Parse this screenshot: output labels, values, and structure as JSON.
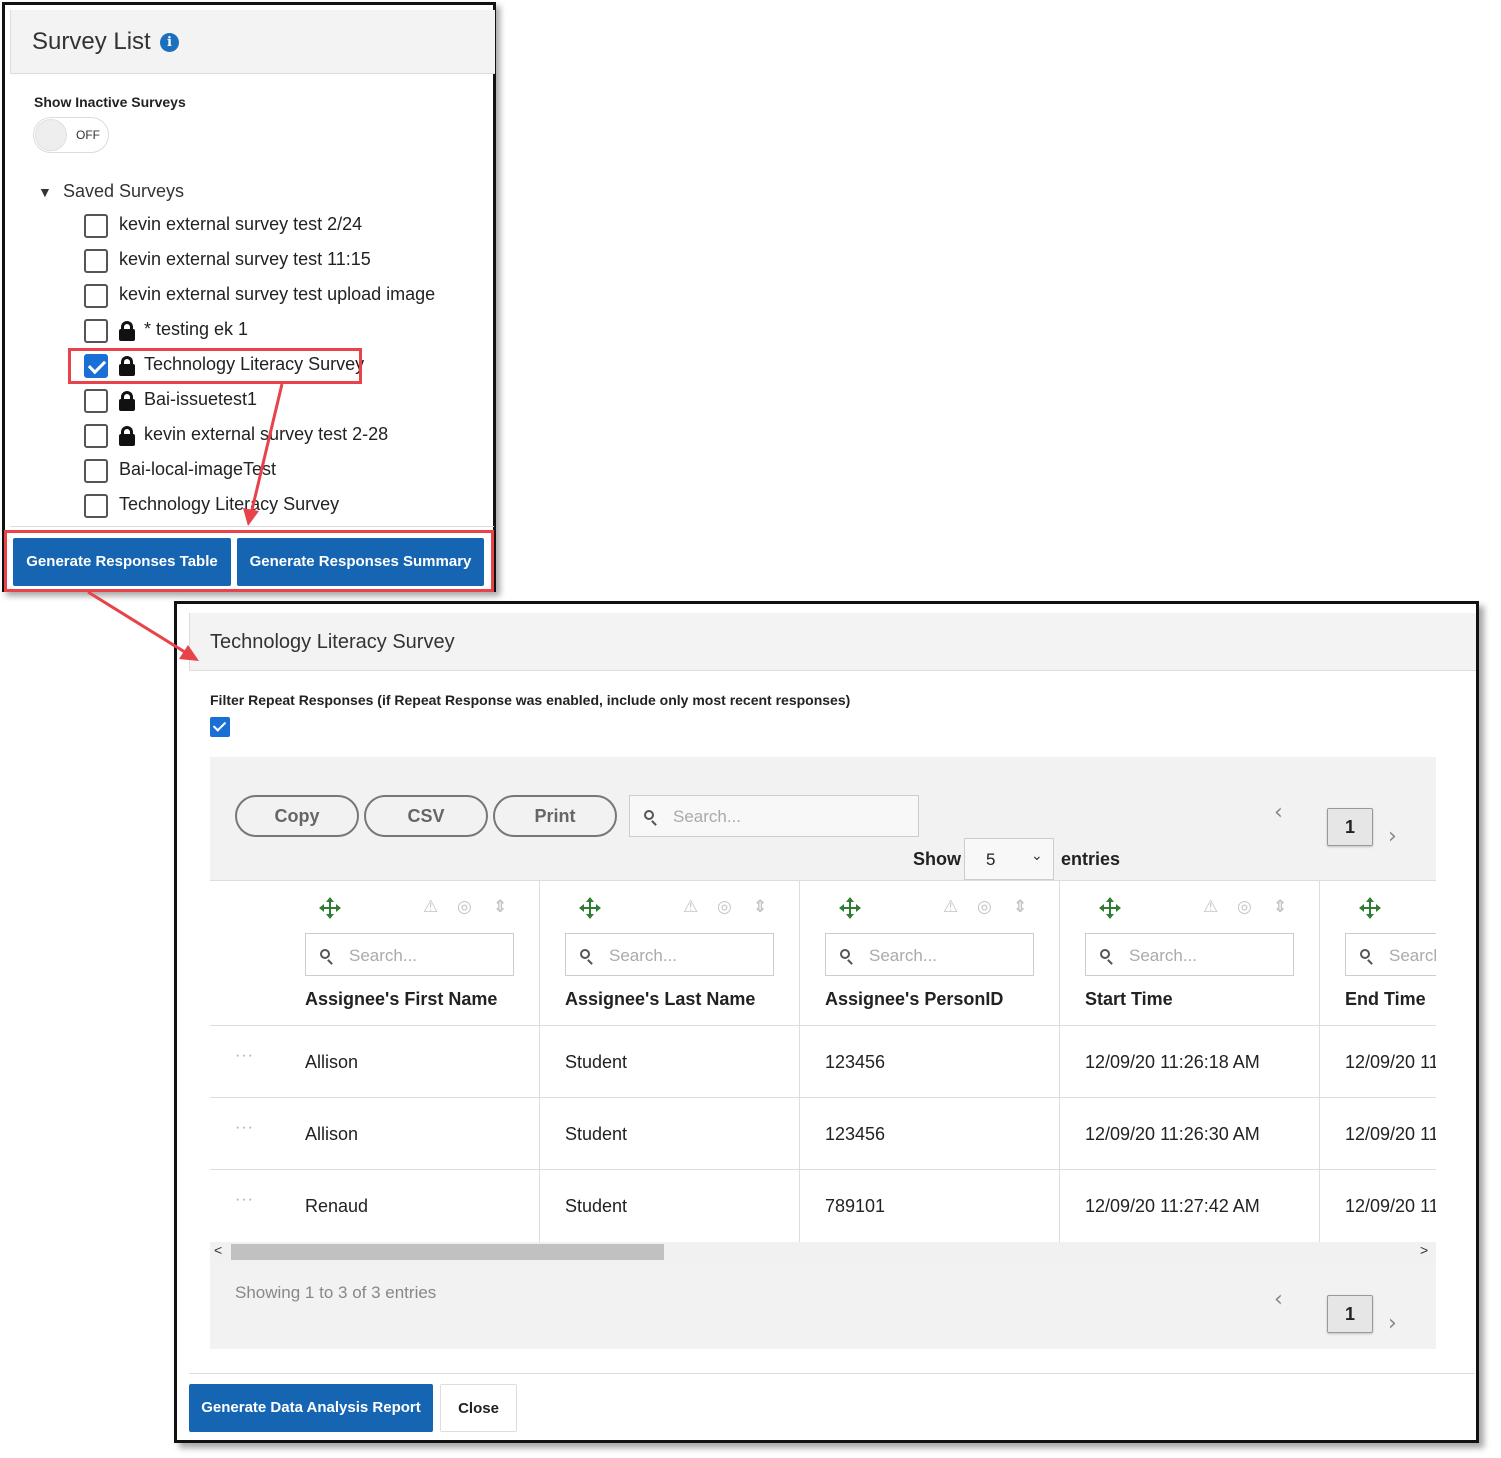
{
  "survey_list": {
    "title": "Survey List",
    "info_icon": "info-icon",
    "show_inactive_label": "Show Inactive Surveys",
    "toggle_state": "OFF",
    "saved_surveys_label": "Saved Surveys",
    "items": [
      {
        "label": "kevin external survey test 2/24",
        "checked": false,
        "locked": false
      },
      {
        "label": "kevin external survey test 11:15",
        "checked": false,
        "locked": false
      },
      {
        "label": "kevin external survey test upload image",
        "checked": false,
        "locked": false
      },
      {
        "label": "* testing ek 1",
        "checked": false,
        "locked": true
      },
      {
        "label": "Technology Literacy Survey",
        "checked": true,
        "locked": true
      },
      {
        "label": "Bai-issuetest1",
        "checked": false,
        "locked": true
      },
      {
        "label": "kevin external survey test 2-28",
        "checked": false,
        "locked": true
      },
      {
        "label": "Bai-local-imageTest",
        "checked": false,
        "locked": false
      },
      {
        "label": "Technology Literacy Survey",
        "checked": false,
        "locked": false
      }
    ],
    "generate_table_label": "Generate Responses Table",
    "generate_summary_label": "Generate Responses Summary"
  },
  "results": {
    "title": "Technology Literacy Survey",
    "filter_label": "Filter Repeat Responses (if Repeat Response was enabled, include only most recent responses)",
    "filter_checked": true,
    "buttons": {
      "copy": "Copy",
      "csv": "CSV",
      "print": "Print"
    },
    "search_placeholder": "Search...",
    "column_search_placeholder": "Search...",
    "column_search_placeholder_truncated": "Search",
    "page_number": "1",
    "show_label": "Show",
    "entries_value": "5",
    "entries_label": "entries",
    "columns": [
      "Assignee's First Name",
      "Assignee's Last Name",
      "Assignee's PersonID",
      "Start Time",
      "End Time"
    ],
    "rows": [
      {
        "first": "Allison",
        "last": "Student",
        "person_id": "123456",
        "start": "12/09/20 11:26:18 AM",
        "end": "12/09/20 11"
      },
      {
        "first": "Allison",
        "last": "Student",
        "person_id": "123456",
        "start": "12/09/20 11:26:30 AM",
        "end": "12/09/20 11"
      },
      {
        "first": "Renaud",
        "last": "Student",
        "person_id": "789101",
        "start": "12/09/20 11:27:42 AM",
        "end": "12/09/20 11"
      }
    ],
    "row_menu": "···",
    "showing_text": "Showing 1 to 3 of 3 entries",
    "generate_analysis_label": "Generate Data Analysis Report",
    "close_label": "Close"
  },
  "colors": {
    "primary_button": "#1565b3",
    "highlight": "#e8424a",
    "checkbox": "#1a6fd6",
    "move_icon": "#2e7d32"
  }
}
